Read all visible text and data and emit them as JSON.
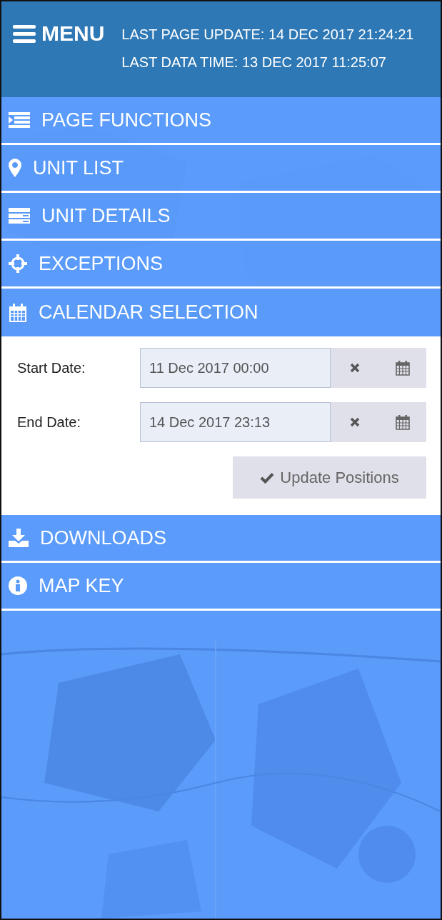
{
  "header": {
    "menu_label": "MENU",
    "last_page_update": "LAST PAGE UPDATE: 14 DEC 2017 21:24:21",
    "last_data_time": "LAST DATA TIME: 13 DEC 2017 11:25:07"
  },
  "menu_items": [
    {
      "label": "PAGE FUNCTIONS",
      "expanded": false
    },
    {
      "label": "UNIT LIST",
      "expanded": false
    },
    {
      "label": "UNIT DETAILS",
      "expanded": false
    },
    {
      "label": "EXCEPTIONS",
      "expanded": false
    },
    {
      "label": "CALENDAR SELECTION",
      "expanded": true
    },
    {
      "label": "DOWNLOADS",
      "expanded": false
    },
    {
      "label": "MAP KEY",
      "expanded": false
    }
  ],
  "calendar_panel": {
    "fields": [
      {
        "label": "Start Date:",
        "value": "11 Dec 2017 00:00"
      },
      {
        "label": "End Date:",
        "value": "14 Dec 2017 23:13"
      }
    ],
    "button": "Update Positions"
  }
}
